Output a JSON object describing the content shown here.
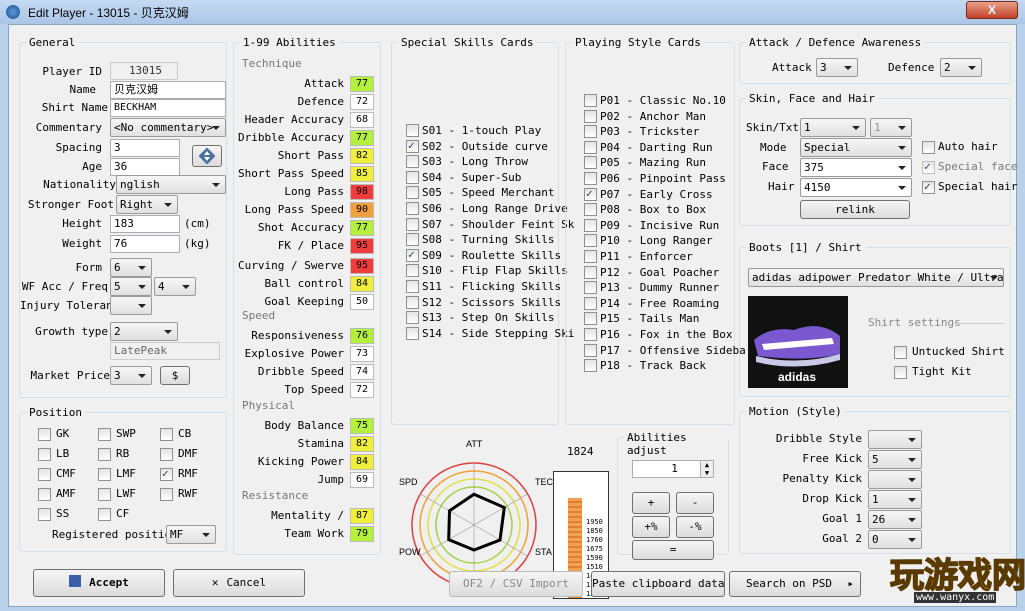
{
  "window": {
    "title": "Edit Player - 13015 - 贝克汉姆",
    "close": "X"
  },
  "general": {
    "title": "General",
    "player_id_label": "Player ID",
    "player_id": "13015",
    "name_label": "Name",
    "name": "贝克汉姆",
    "shirt_label": "Shirt Name",
    "shirt": "BECKHAM",
    "comm_label": "Commentary",
    "comm": "<No commentary>",
    "spacing_label": "Spacing",
    "spacing": "3",
    "age_label": "Age",
    "age": "36",
    "nat_label": "Nationality",
    "nat": "nglish",
    "foot_label": "Stronger Foot",
    "foot": "Right",
    "height_label": "Height",
    "height": "183",
    "cm": "(cm)",
    "weight_label": "Weight",
    "weight": "76",
    "kg": "(kg)",
    "form_label": "Form",
    "form": "6",
    "wf_label": "WF Acc / Freq",
    "wf1": "5",
    "wf2": "4",
    "injury_label": "Injury Tolerance",
    "injury": "",
    "growth_label": "Growth type",
    "growth": "2",
    "growth_name": "LatePeak",
    "market_label": "Market Price",
    "market": "3",
    "dollar": "$"
  },
  "position": {
    "title": "Position",
    "items": [
      "GK",
      "SWP",
      "CB",
      "LB",
      "RB",
      "DMF",
      "CMF",
      "LMF",
      "RMF",
      "AMF",
      "LWF",
      "RWF",
      "SS",
      "CF"
    ],
    "checked": [
      false,
      false,
      false,
      false,
      false,
      false,
      false,
      false,
      true,
      false,
      false,
      false,
      false,
      false
    ],
    "reg_label": "Registered position",
    "reg": "MF"
  },
  "abilities": {
    "title": "1-99 Abilities",
    "technique": "Technique",
    "speed": "Speed",
    "physical": "Physical",
    "resistance": "Resistance",
    "items": [
      {
        "label": "Attack",
        "value": "77",
        "color": "#b4f03c"
      },
      {
        "label": "Defence",
        "value": "72",
        "color": "#ffffff"
      },
      {
        "label": "Header Accuracy",
        "value": "68",
        "color": "#ffffff"
      },
      {
        "label": "Dribble Accuracy",
        "value": "77",
        "color": "#b4f03c"
      },
      {
        "label": "Short Pass",
        "value": "82",
        "color": "#f0f03c"
      },
      {
        "label": "Short Pass Speed",
        "value": "85",
        "color": "#f0f03c"
      },
      {
        "label": "Long Pass",
        "value": "98",
        "color": "#f03c3c"
      },
      {
        "label": "Long Pass Speed",
        "value": "90",
        "color": "#f0a03c"
      },
      {
        "label": "Shot Accuracy",
        "value": "77",
        "color": "#b4f03c"
      },
      {
        "label": "FK / Place",
        "value": "95",
        "color": "#f03c3c"
      },
      {
        "label": "Curving / Swerve",
        "value": "95",
        "color": "#f03c3c"
      },
      {
        "label": "Ball control",
        "value": "84",
        "color": "#f0f03c"
      },
      {
        "label": "Goal Keeping",
        "value": "50",
        "color": "#ffffff"
      },
      {
        "label": "Responsiveness",
        "value": "76",
        "color": "#b4f03c"
      },
      {
        "label": "Explosive Power",
        "value": "73",
        "color": "#ffffff"
      },
      {
        "label": "Dribble Speed",
        "value": "74",
        "color": "#ffffff"
      },
      {
        "label": "Top Speed",
        "value": "72",
        "color": "#ffffff"
      },
      {
        "label": "Body Balance",
        "value": "75",
        "color": "#b4f03c"
      },
      {
        "label": "Stamina",
        "value": "82",
        "color": "#f0f03c"
      },
      {
        "label": "Kicking Power",
        "value": "84",
        "color": "#f0f03c"
      },
      {
        "label": "Jump",
        "value": "69",
        "color": "#ffffff"
      },
      {
        "label": "Mentality /",
        "value": "87",
        "color": "#f0f03c"
      },
      {
        "label": "Team Work",
        "value": "79",
        "color": "#b4f03c"
      }
    ]
  },
  "skills": {
    "title": "Special Skills Cards",
    "items": [
      "S01 - 1-touch Play",
      "S02 - Outside curve",
      "S03 - Long Throw",
      "S04 - Super-Sub",
      "S05 - Speed Merchant",
      "S06 - Long Range Drive",
      "S07 - Shoulder Feint Sk",
      "S08 - Turning Skills",
      "S09 - Roulette Skills",
      "S10 - Flip Flap Skills",
      "S11 - Flicking Skills",
      "S12 - Scissors Skills",
      "S13 - Step On Skills",
      "S14 - Side Stepping Ski"
    ],
    "checked": [
      false,
      true,
      false,
      false,
      false,
      false,
      false,
      false,
      true,
      false,
      false,
      false,
      false,
      false
    ]
  },
  "styles": {
    "title": "Playing Style Cards",
    "items": [
      "P01 - Classic No.10",
      "P02 - Anchor Man",
      "P03 - Trickster",
      "P04 - Darting Run",
      "P05 - Mazing Run",
      "P06 - Pinpoint Pass",
      "P07 - Early Cross",
      "P08 - Box to Box",
      "P09 - Incisive Run",
      "P10 - Long Ranger",
      "P11 - Enforcer",
      "P12 - Goal Poacher",
      "P13 - Dummy Runner",
      "P14 - Free Roaming",
      "P15 - Tails Man",
      "P16 - Fox in the Box",
      "P17 - Offensive Sideba",
      "P18 - Track Back"
    ],
    "checked": [
      false,
      false,
      false,
      false,
      false,
      false,
      true,
      false,
      false,
      false,
      false,
      false,
      false,
      false,
      false,
      false,
      false,
      false
    ]
  },
  "awareness": {
    "title": "Attack / Defence Awareness",
    "attack_label": "Attack",
    "attack": "3",
    "defence_label": "Defence",
    "defence": "2"
  },
  "skin": {
    "title": "Skin, Face and Hair",
    "skin_label": "Skin/Txt",
    "skin1": "1",
    "skin2": "1",
    "mode_label": "Mode",
    "mode": "Special",
    "face_label": "Face",
    "face": "375",
    "hair_label": "Hair",
    "hair": "4150",
    "auto_hair": "Auto hair",
    "special_face": "Special face",
    "special_hair": "Special hair",
    "relink": "relink"
  },
  "boots": {
    "title": "Boots [1] / Shirt",
    "boot": "adidas adipower Predator White / Ultra",
    "brand": "adidas",
    "shirt_settings": "Shirt settings",
    "untucked": "Untucked Shirt",
    "tight": "Tight Kit"
  },
  "motion": {
    "title": "Motion (Style)",
    "dribble_label": "Dribble Style",
    "dribble": "",
    "fk_label": "Free Kick",
    "fk": "5",
    "pk_label": "Penalty Kick",
    "pk": "",
    "dk_label": "Drop Kick",
    "dk": "1",
    "g1_label": "Goal 1",
    "g1": "26",
    "g2_label": "Goal 2",
    "g2": "0"
  },
  "radar": {
    "att": "ATT",
    "spd": "SPD",
    "tec": "TEC",
    "pow": "POW",
    "sta": "STA",
    "def": "DEF",
    "values": [
      77,
      82,
      76,
      70,
      75,
      74
    ]
  },
  "meter": {
    "total": "1824",
    "ticks": [
      "1950",
      "1850",
      "1760",
      "1675",
      "1590",
      "1510",
      "1475",
      "1350",
      "1295"
    ]
  },
  "adjust": {
    "title": "Abilities adjust",
    "value": "1",
    "plus": "+",
    "minus": "-",
    "plus_pct": "+%",
    "minus_pct": "-%",
    "equal": "="
  },
  "buttons": {
    "accept": "Accept",
    "cancel": "Cancel",
    "csv": "OF2 / CSV Import",
    "paste": "Paste clipboard data",
    "search": "Search on PSD"
  },
  "watermark": {
    "text": "玩游戏网",
    "url": "www.wanyx.com"
  }
}
